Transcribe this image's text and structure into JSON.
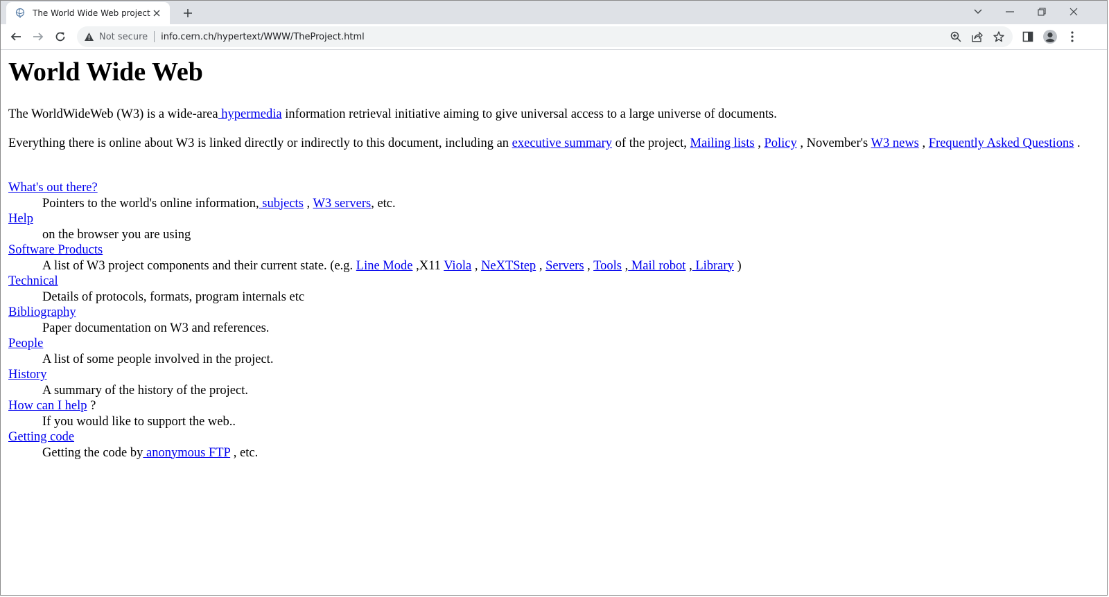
{
  "browser": {
    "tab_title": "The World Wide Web project",
    "security_label": "Not secure",
    "url": "info.cern.ch/hypertext/WWW/TheProject.html",
    "icons": [
      "globe-favicon-icon",
      "close-icon",
      "plus-icon",
      "chevron-down-icon",
      "minimize-icon",
      "restore-icon",
      "window-close-icon",
      "back-arrow-icon",
      "forward-arrow-icon",
      "reload-icon",
      "warning-icon",
      "zoom-icon",
      "share-icon",
      "star-icon",
      "side-panel-icon",
      "profile-icon",
      "kebab-menu-icon"
    ]
  },
  "page": {
    "title": "World Wide Web",
    "intro": {
      "before": "The WorldWideWeb (W3) is a wide-area",
      "link": " hypermedia",
      "after": " information retrieval initiative aiming to give universal access to a large universe of documents."
    },
    "everything": {
      "t1": "Everything there is online about W3 is linked directly or indirectly to this document, including an ",
      "l1": "executive summary",
      "t2": " of the project, ",
      "l2": "Mailing lists",
      "t3": " , ",
      "l3": "Policy",
      "t4": " , November's ",
      "l4": "W3 news",
      "t5": " , ",
      "l5": "Frequently Asked Questions",
      "t6": " ."
    },
    "list": {
      "whats_out": {
        "term": "What's out there?",
        "t1": "Pointers to the world's online information,",
        "l1": " subjects",
        "t2": " , ",
        "l2": "W3 servers",
        "t3": ", etc."
      },
      "help": {
        "term": "Help",
        "desc": "on the browser you are using"
      },
      "software": {
        "term": "Software Products",
        "t1": "A list of W3 project components and their current state. (e.g. ",
        "l1": "Line Mode",
        "t2": " ,X11 ",
        "l2": "Viola",
        "t3": " , ",
        "l3": "NeXTStep",
        "t4": " , ",
        "l4": "Servers",
        "t5": " , ",
        "l5": "Tools",
        "t6": " ,",
        "l6": " Mail robot",
        "t7": " ,",
        "l7": " Library",
        "t8": " )"
      },
      "technical": {
        "term": "Technical",
        "desc": "Details of protocols, formats, program internals etc"
      },
      "bibliography": {
        "term": "Bibliography",
        "desc": "Paper documentation on W3 and references."
      },
      "people": {
        "term": "People",
        "desc": "A list of some people involved in the project."
      },
      "history": {
        "term": "History",
        "desc": "A summary of the history of the project."
      },
      "howcan": {
        "term": "How can I help",
        "suffix": " ?",
        "desc": "If you would like to support the web.."
      },
      "getting": {
        "term": "Getting code",
        "t1": "Getting the code by",
        "l1": " anonymous FTP",
        "t2": " , etc."
      }
    }
  }
}
